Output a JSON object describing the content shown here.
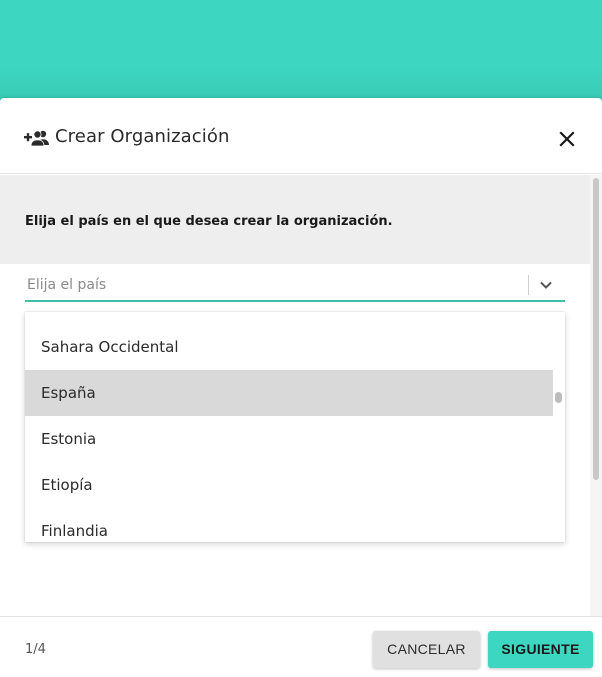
{
  "modal": {
    "title": "Crear Organización",
    "instruction": "Elija el país en el que desea crear la organización.",
    "country_select": {
      "placeholder": "Elija el país",
      "options": [
        {
          "label": "Sahara Occidental",
          "active": false
        },
        {
          "label": "España",
          "active": true
        },
        {
          "label": "Estonia",
          "active": false
        },
        {
          "label": "Etiopía",
          "active": false
        },
        {
          "label": "Finlandia",
          "active": false
        }
      ]
    },
    "footer": {
      "step": "1/4",
      "cancel_label": "CANCELAR",
      "next_label": "SIGUIENTE"
    }
  },
  "icons": {
    "header": "add-group-icon",
    "close": "close-icon",
    "select": "chevron-down-icon"
  },
  "colors": {
    "accent": "#3dd6c0",
    "field_underline": "#3dbfab",
    "active_option": "#d9d9d9",
    "cancel_button": "#e0e0e0"
  }
}
